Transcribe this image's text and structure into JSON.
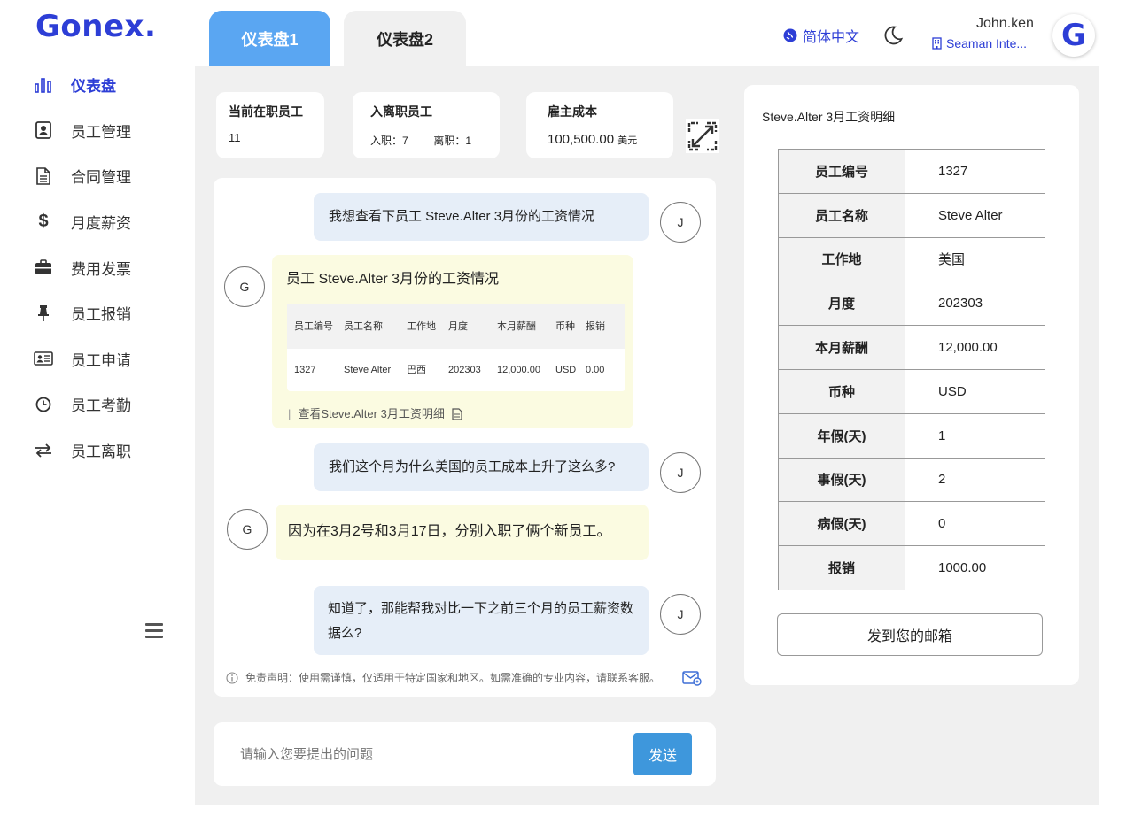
{
  "brand": {
    "logo": "Gonex."
  },
  "sidebar": {
    "items": [
      {
        "label": "仪表盘",
        "icon": "bar-chart-icon"
      },
      {
        "label": "员工管理",
        "icon": "contact-card-icon"
      },
      {
        "label": "合同管理",
        "icon": "document-icon"
      },
      {
        "label": "月度薪资",
        "icon": "dollar-icon"
      },
      {
        "label": "费用发票",
        "icon": "briefcase-icon"
      },
      {
        "label": "员工报销",
        "icon": "pin-icon"
      },
      {
        "label": "员工申请",
        "icon": "id-card-icon"
      },
      {
        "label": "员工考勤",
        "icon": "clock-icon"
      },
      {
        "label": "员工离职",
        "icon": "exchange-icon"
      }
    ]
  },
  "tabs": [
    {
      "label": "仪表盘1",
      "active": true
    },
    {
      "label": "仪表盘2",
      "active": false
    }
  ],
  "header": {
    "language": "简体中文",
    "user_name": "John.ken",
    "company": "Seaman Inte...",
    "avatar_letter": "G"
  },
  "stats": {
    "current_staff": {
      "title": "当前在职员工",
      "value": "11"
    },
    "onboard_offboard": {
      "title": "入离职员工",
      "in_label": "入职：",
      "in_value": "7",
      "out_label": "离职：",
      "out_value": "1"
    },
    "employer_cost": {
      "title": "雇主成本",
      "value": "100,500.00",
      "unit": "美元"
    }
  },
  "chat": {
    "messages": [
      {
        "role": "user",
        "avatar": "J",
        "text": "我想查看下员工 Steve.Alter 3月份的工资情况"
      },
      {
        "role": "bot",
        "avatar": "G",
        "text": "员工 Steve.Alter 3月份的工资情况"
      },
      {
        "role": "user",
        "avatar": "J",
        "text": "我们这个月为什么美国的员工成本上升了这么多?"
      },
      {
        "role": "bot",
        "avatar": "G",
        "text": "因为在3月2号和3月17日，分别入职了俩个新员工。"
      },
      {
        "role": "user",
        "avatar": "J",
        "text": "知道了，那能帮我对比一下之前三个月的员工薪资数据么?"
      }
    ],
    "mini_table": {
      "headers": [
        "员工编号",
        "员工名称",
        "工作地",
        "月度",
        "本月薪酬",
        "币种",
        "报销"
      ],
      "row": [
        "1327",
        "Steve Alter",
        "巴西",
        "202303",
        "12,000.00",
        "USD",
        "0.00"
      ]
    },
    "view_link": "查看Steve.Alter 3月工资明细",
    "disclaimer": "免责声明：使用需谨慎，仅适用于特定国家和地区。如需准确的专业内容，请联系客服。"
  },
  "input": {
    "placeholder": "请输入您要提出的问题",
    "send_label": "发送"
  },
  "detail": {
    "title": "Steve.Alter 3月工资明细",
    "rows": [
      {
        "key": "员工编号",
        "value": "1327"
      },
      {
        "key": "员工名称",
        "value": "Steve Alter"
      },
      {
        "key": "工作地",
        "value": "美国"
      },
      {
        "key": "月度",
        "value": "202303"
      },
      {
        "key": "本月薪酬",
        "value": "12,000.00"
      },
      {
        "key": "币种",
        "value": "USD"
      },
      {
        "key": "年假(天)",
        "value": "1"
      },
      {
        "key": "事假(天)",
        "value": "2"
      },
      {
        "key": "病假(天)",
        "value": "0"
      },
      {
        "key": "报销",
        "value": "1000.00"
      }
    ],
    "email_button": "发到您的邮箱"
  },
  "colors": {
    "brand": "#2d3ed6",
    "tab_active": "#5aa6f2",
    "send": "#3e97dc",
    "user_bubble": "#e6eef8",
    "bot_bubble": "#fbfbe1"
  }
}
